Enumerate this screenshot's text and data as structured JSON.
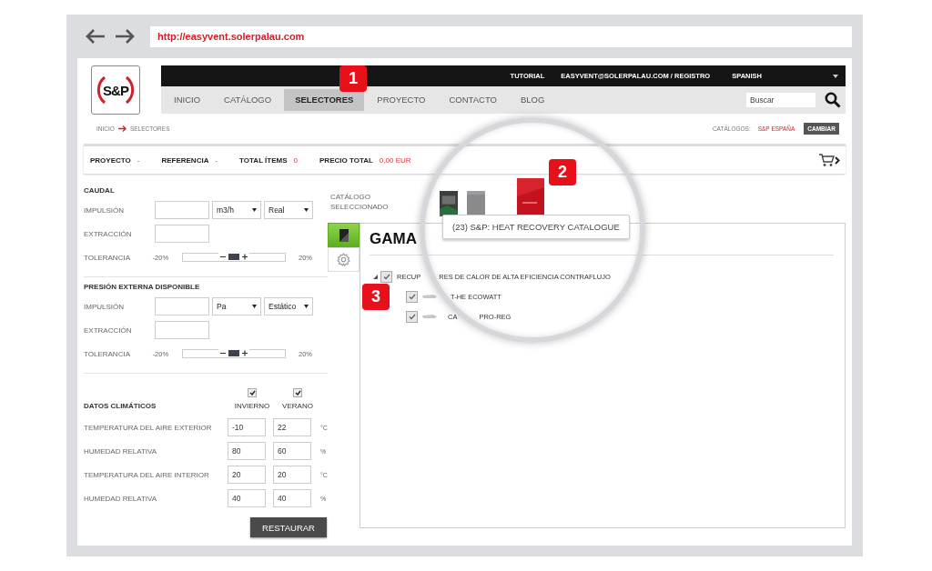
{
  "browser": {
    "url": "http://easyvent.solerpalau.com"
  },
  "logo": "S&P",
  "top_links": [
    "TUTORIAL",
    "EASYVENT@SOLERPALAU.COM / REGISTRO"
  ],
  "language": "SPANISH",
  "nav": [
    {
      "label": "INICIO",
      "selected": false
    },
    {
      "label": "CATÁLOGO",
      "selected": false
    },
    {
      "label": "SELECTORES",
      "selected": true
    },
    {
      "label": "PROYECTO",
      "selected": false
    },
    {
      "label": "CONTACTO",
      "selected": false
    },
    {
      "label": "BLOG",
      "selected": false
    }
  ],
  "search": {
    "placeholder": "Buscar"
  },
  "breadcrumb": [
    "INICIO",
    "SELECTORES"
  ],
  "catalogs": {
    "label": "CATÁLOGOS:",
    "value": "S&P ESPAÑA",
    "button": "CAMBIAR"
  },
  "summary": [
    {
      "label": "PROYECTO",
      "value": "-"
    },
    {
      "label": "REFERENCIA",
      "value": "-"
    },
    {
      "label": "TOTAL ÍTEMS",
      "value": "0"
    },
    {
      "label": "PRECIO TOTAL",
      "value": "0,00 EUR"
    }
  ],
  "sections": [
    {
      "title": "CAUDAL",
      "rows": [
        {
          "kind": "input",
          "label": "IMPULSIÓN",
          "selects": [
            "m3/h",
            "Real"
          ]
        },
        {
          "kind": "input",
          "label": "EXTRACCIÓN"
        },
        {
          "kind": "slider",
          "label": "TOLERANCIA",
          "min": "-20%",
          "max": "20%",
          "level": 0.5
        }
      ]
    },
    {
      "title": "PRESIÓN EXTERNA DISPONIBLE",
      "rows": [
        {
          "kind": "input",
          "label": "IMPULSIÓN",
          "selects": [
            "Pa",
            "Estático"
          ]
        },
        {
          "kind": "input",
          "label": "EXTRACCIÓN"
        },
        {
          "kind": "slider",
          "label": "TOLERANCIA",
          "min": "-20%",
          "max": "20%",
          "level": 0.5
        }
      ]
    }
  ],
  "climate": {
    "title": "DATOS CLIMÁTICOS",
    "columns": [
      {
        "label": "INVIERNO",
        "checked": true
      },
      {
        "label": "VERANO",
        "checked": true
      }
    ],
    "rows": [
      {
        "label": "TEMPERATURA DEL AIRE EXTERIOR",
        "values": [
          "-10",
          "22"
        ],
        "unit": "°C"
      },
      {
        "label": "HUMEDAD RELATIVA",
        "values": [
          "80",
          "60"
        ],
        "unit": "%"
      },
      {
        "label": "TEMPERATURA DEL AIRE INTERIOR",
        "values": [
          "20",
          "20"
        ],
        "unit": "°C"
      },
      {
        "label": "HUMEDAD RELATIVA",
        "values": [
          "40",
          "40"
        ],
        "unit": "%"
      }
    ]
  },
  "restore_button": "RESTAURAR",
  "catalog": {
    "label": "CATÁLOGO SELECCIONADO",
    "side_tabs": [
      {
        "kind": "catalogue",
        "selected": true
      },
      {
        "kind": "settings",
        "selected": false
      }
    ],
    "thumbnails": [
      {
        "selected": false
      },
      {
        "selected": false
      },
      {
        "selected": true
      }
    ],
    "tooltip": "(23) S&P: HEAT RECOVERY CATALOGUE",
    "heading": "GAMA",
    "tree": [
      {
        "label_parts": [
          "RECUP",
          "RES DE CALOR DE ALTA EFICIENCIA CONTRAFLUJO"
        ],
        "checked": true,
        "expanded": true,
        "children": [
          {
            "label_parts": [
              "T-HE ECOWATT"
            ],
            "checked": true
          },
          {
            "label_parts": [
              "CA",
              "PRO-REG"
            ],
            "checked": true
          }
        ]
      }
    ]
  },
  "badges": [
    "1",
    "2",
    "3"
  ]
}
